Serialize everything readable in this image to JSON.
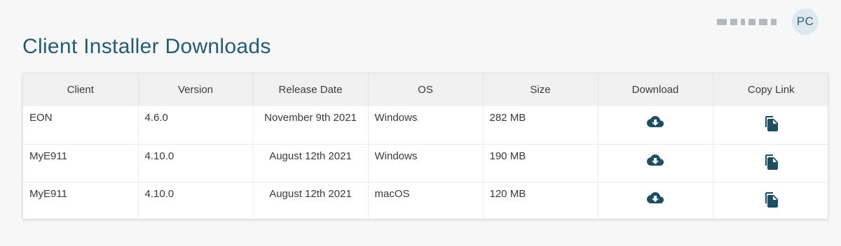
{
  "header": {
    "title": "Client Installer Downloads",
    "user_initials": "PC"
  },
  "table": {
    "columns": [
      "Client",
      "Version",
      "Release Date",
      "OS",
      "Size",
      "Download",
      "Copy Link"
    ],
    "rows": [
      {
        "client": "EON",
        "version": "4.6.0",
        "release_date": "November 9th 2021",
        "os": "Windows",
        "size": "282 MB"
      },
      {
        "client": "MyE911",
        "version": "4.10.0",
        "release_date": "August 12th 2021",
        "os": "Windows",
        "size": "190 MB"
      },
      {
        "client": "MyE911",
        "version": "4.10.0",
        "release_date": "August 12th 2021",
        "os": "macOS",
        "size": "120 MB"
      }
    ],
    "download_icon": "cloud-download-icon",
    "copy_icon": "copy-icon"
  },
  "colors": {
    "title": "#255c73",
    "icon": "#1e4e63",
    "header_bg": "#f0f0f0"
  }
}
